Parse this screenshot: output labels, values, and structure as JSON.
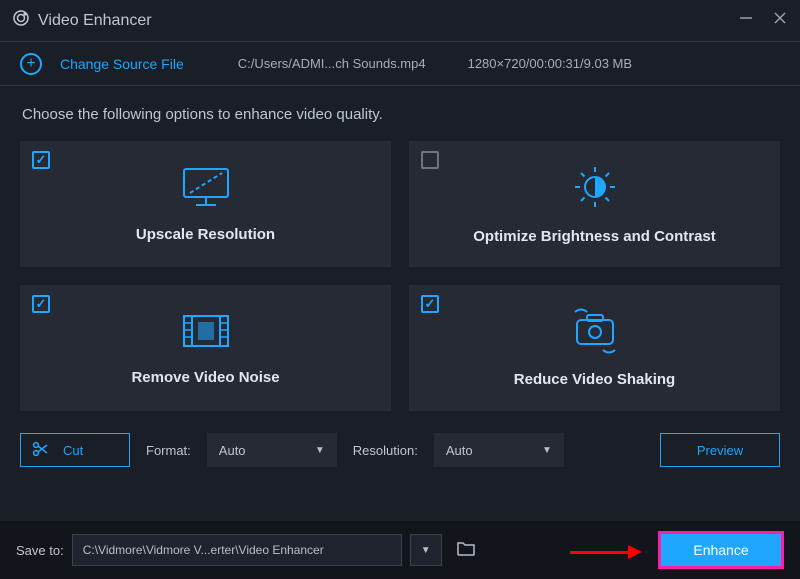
{
  "title": "Video Enhancer",
  "source": {
    "change_label": "Change Source File",
    "path": "C:/Users/ADMI...ch Sounds.mp4",
    "meta": "1280×720/00:00:31/9.03 MB"
  },
  "instruction": "Choose the following options to enhance video quality.",
  "cards": {
    "upscale": {
      "label": "Upscale Resolution",
      "checked": true
    },
    "brightness": {
      "label": "Optimize Brightness and Contrast",
      "checked": false
    },
    "noise": {
      "label": "Remove Video Noise",
      "checked": true
    },
    "shaking": {
      "label": "Reduce Video Shaking",
      "checked": true
    }
  },
  "controls": {
    "cut_label": "Cut",
    "format_label": "Format:",
    "format_value": "Auto",
    "resolution_label": "Resolution:",
    "resolution_value": "Auto",
    "preview_label": "Preview"
  },
  "bottom": {
    "save_to_label": "Save to:",
    "path": "C:\\Vidmore\\Vidmore V...erter\\Video Enhancer",
    "enhance_label": "Enhance"
  }
}
